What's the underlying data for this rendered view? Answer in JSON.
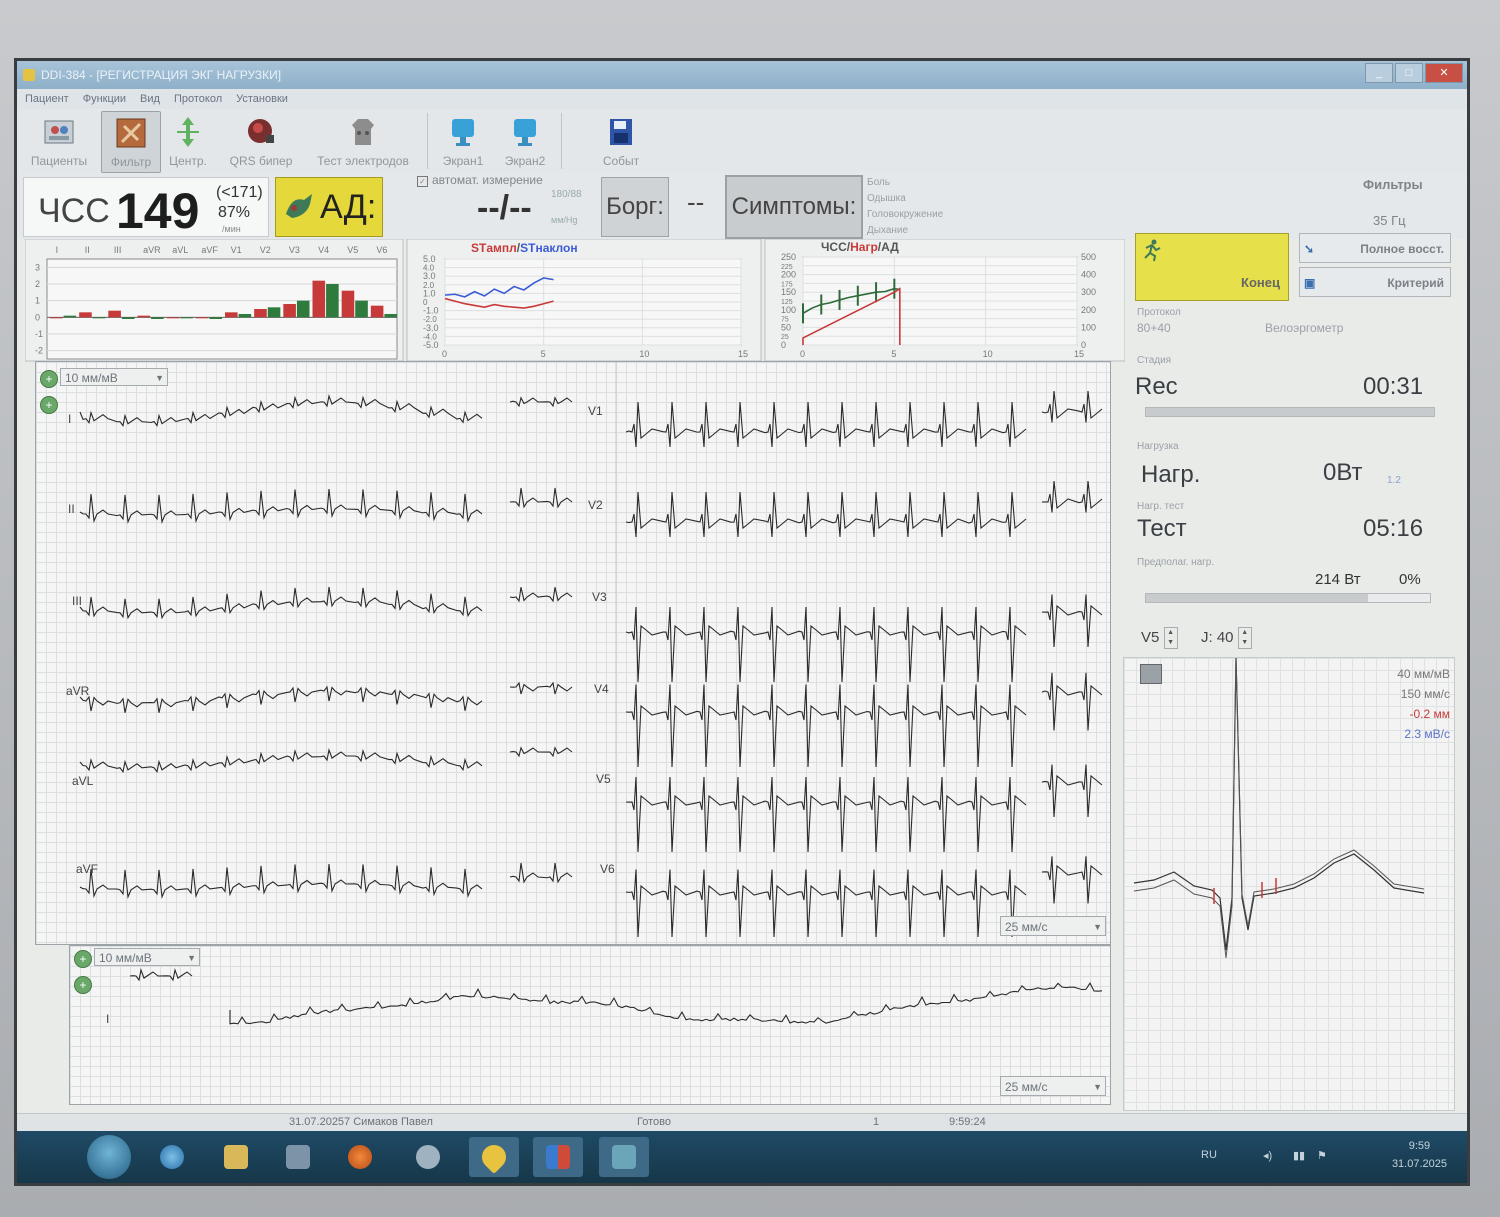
{
  "window": {
    "title": "DDI-384 - [РЕГИСТРАЦИЯ ЭКГ НАГРУЗКИ]",
    "menu": [
      "Пациент",
      "Функции",
      "Вид",
      "Протокол",
      "Установки"
    ]
  },
  "toolbar": {
    "buttons": [
      {
        "label": "Пациенты",
        "icon": "patients-icon"
      },
      {
        "label": "Фильтр",
        "icon": "filter-icon",
        "active": true
      },
      {
        "label": "Центр.",
        "icon": "center-icon"
      },
      {
        "label": "QRS бипер",
        "icon": "qrs-beeper-icon"
      },
      {
        "label": "Тест электродов",
        "icon": "electrode-test-icon"
      },
      {
        "label": "Экран1",
        "icon": "screen1-icon"
      },
      {
        "label": "Экран2",
        "icon": "screen2-icon"
      },
      {
        "label": "Событ",
        "icon": "event-icon"
      }
    ]
  },
  "vitals": {
    "hr_label": "ЧСС",
    "hr_value": "149",
    "hr_max": "(<171)",
    "hr_percent": "87%",
    "hr_unit": "/мин",
    "ad_label": "АД:",
    "auto_measure": "автомат. измерение",
    "bp_value": "--/--",
    "bp_small": "180/88",
    "bp_unit": "мм/Hg",
    "borg_label": "Борг:",
    "borg_value": "--",
    "symptoms_label": "Симптомы:",
    "symptoms": [
      "Боль",
      "Одышка",
      "Головокружение",
      "Дыхание"
    ],
    "filters_label": "Фильтры",
    "filters_value": "35 Гц"
  },
  "st_bar_chart": {
    "leads": [
      "I",
      "II",
      "III",
      "aVR",
      "aVL",
      "aVF",
      "V1",
      "V2",
      "V3",
      "V4",
      "V5",
      "V6"
    ],
    "yticks": [
      "3",
      "2",
      "1",
      "0",
      "-1",
      "-2"
    ]
  },
  "chart_data": [
    {
      "type": "bar",
      "categories": [
        "I",
        "I",
        "II",
        "II",
        "III",
        "III",
        "aVR",
        "aVR",
        "aVL",
        "aVL",
        "aVF",
        "aVF",
        "V1",
        "V1",
        "V2",
        "V2",
        "V3",
        "V3",
        "V4",
        "V4",
        "V5",
        "V5",
        "V6",
        "V6"
      ],
      "series": [
        {
          "values": [
            0.0,
            0.1,
            0.3,
            0.0,
            0.4,
            -0.1,
            0.1,
            -0.1,
            0.0,
            0.0,
            0.0,
            -0.1,
            0.3,
            0.2,
            0.5,
            0.6,
            0.8,
            1.0,
            2.2,
            2.0,
            1.6,
            1.0,
            0.7,
            0.2
          ]
        }
      ],
      "ylim": [
        -2.5,
        3.5
      ]
    },
    {
      "type": "line",
      "title_a": "STампл",
      "title_b": "STнаклон",
      "xticks": [
        "0",
        "5",
        "10",
        "15"
      ],
      "yticks": [
        "5.0",
        "3.0",
        "1.0",
        "-1.0",
        "-3.0",
        "-5.0"
      ],
      "ytick_extra": [
        "4.0",
        "2.0",
        "0",
        "-2.0",
        "-4.0"
      ],
      "xlim": [
        0,
        15
      ],
      "ylim": [
        -5,
        5
      ],
      "series": [
        {
          "color": "#3b5bd6",
          "x": [
            0,
            0.5,
            1,
            1.5,
            2,
            2.5,
            3,
            3.5,
            4,
            4.5,
            5,
            5.5
          ],
          "y": [
            0.8,
            0.9,
            0.6,
            1.2,
            0.7,
            1.5,
            1.0,
            1.8,
            1.4,
            2.2,
            2.8,
            2.6
          ]
        },
        {
          "color": "#c83a3a",
          "x": [
            0,
            0.5,
            1,
            1.5,
            2,
            2.5,
            3,
            3.5,
            4,
            4.5,
            5,
            5.5
          ],
          "y": [
            0.4,
            0.1,
            -0.2,
            -0.4,
            -0.6,
            -0.3,
            -0.5,
            -0.6,
            -0.7,
            -0.5,
            -0.2,
            0.1
          ]
        }
      ]
    },
    {
      "type": "line",
      "title_a": "ЧСС",
      "title_b": "Нагр",
      "title_c": "АД",
      "xticks": [
        "0",
        "5",
        "10",
        "15"
      ],
      "yticks_left": [
        "250",
        "200",
        "150",
        "100",
        "50",
        "0"
      ],
      "yticks_left_minor": [
        "225",
        "175",
        "125",
        "75",
        "25"
      ],
      "yticks_right": [
        "500",
        "400",
        "300",
        "200",
        "100",
        "0"
      ],
      "xlim": [
        0,
        15
      ],
      "ylim": [
        0,
        250
      ],
      "series": [
        {
          "color": "#2e6b3a",
          "x": [
            0,
            0.5,
            1,
            1.5,
            2,
            2.5,
            3,
            3.5,
            4,
            4.5,
            5,
            5.3
          ],
          "y": [
            90,
            105,
            115,
            120,
            128,
            135,
            140,
            145,
            150,
            152,
            160,
            158
          ]
        },
        {
          "color": "#c83a3a",
          "x": [
            0,
            0,
            5,
            5.3,
            5.3
          ],
          "y": [
            0,
            20,
            150,
            160,
            0
          ]
        }
      ]
    }
  ],
  "ecg": {
    "gain_top": "10 мм/мВ",
    "gain_bottom": "10 мм/мВ",
    "speed_top": "25 мм/с",
    "speed_bottom": "25 мм/с",
    "limb_leads": [
      "I",
      "II",
      "III",
      "aVR",
      "aVL",
      "aVF"
    ],
    "chest_leads": [
      "V1",
      "V2",
      "V3",
      "V4",
      "V5",
      "V6"
    ],
    "rhythm_lead": "I"
  },
  "right_panel": {
    "end_label": "Конец",
    "full_recovery": "Полное восст.",
    "criteria": "Критерий",
    "protocol_small": "Протокол",
    "protocol_value": "80+40",
    "device": "Велоэргометр",
    "stage_small": "Стадия",
    "stage_label": "Rec",
    "stage_time": "00:31",
    "load_small": "Нагрузка",
    "load_label": "Нагр.",
    "load_value": "0Вт",
    "load_extra": "1.2",
    "test_small": "Нагр. тест",
    "test_label": "Тест",
    "test_time": "05:16",
    "predicted_small": "Предполаг. нагр.",
    "predicted_value": "214 Вт",
    "predicted_percent": "0%",
    "predicted_fill": 0.78,
    "stage_fill": 1.0,
    "lead_select": "V5",
    "j_label": "J: 40",
    "beat_gain": "40 мм/мВ",
    "beat_speed": "150 мм/с",
    "beat_st": "-0.2 мм",
    "beat_slope": "2.3 мВ/с"
  },
  "statusbar": {
    "patient": "31.07.20257  Симаков Павел",
    "state": "Готово",
    "page": "1",
    "time": "9:59:24"
  },
  "taskbar": {
    "lang": "RU",
    "clock": "9:59",
    "date": "31.07.2025"
  },
  "colors": {
    "accent_yellow": "#e4d83a",
    "st_amp": "#c83a3a",
    "st_slope": "#3b5bd6",
    "hr_trend": "#2e6b3a"
  }
}
